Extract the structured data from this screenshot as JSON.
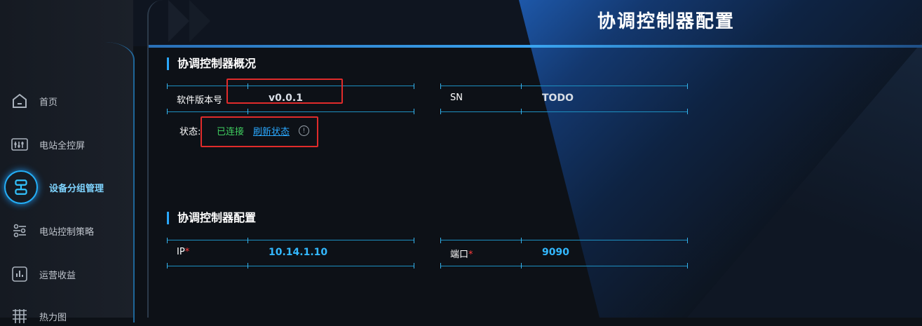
{
  "page": {
    "title": "协调控制器配置"
  },
  "sidebar": {
    "items": [
      {
        "label": "首页",
        "icon": "home-icon",
        "active": false
      },
      {
        "label": "电站全控屏",
        "icon": "sliders-icon",
        "active": false
      },
      {
        "label": "设备分组管理",
        "icon": "group-icon",
        "active": true
      },
      {
        "label": "电站控制策略",
        "icon": "strategy-icon",
        "active": false
      },
      {
        "label": "运营收益",
        "icon": "bar-chart-icon",
        "active": false
      },
      {
        "label": "热力图",
        "icon": "heatmap-icon",
        "active": false
      }
    ]
  },
  "overview": {
    "title": "协调控制器概况",
    "software_version_label": "软件版本号",
    "software_version_value": "v0.0.1",
    "sn_label": "SN",
    "sn_value": "TODO",
    "status_label": "状态:",
    "status_value": "已连接",
    "refresh_label": "刷新状态",
    "info_glyph": "!"
  },
  "config": {
    "title": "协调控制器配置",
    "ip_label": "IP",
    "ip_value": "10.14.1.10",
    "port_label": "端口",
    "port_value": "9090",
    "required_mark": "*"
  },
  "colors": {
    "accent": "#2aa8ff",
    "connected": "#40d060",
    "annotation": "#e02b2b"
  }
}
